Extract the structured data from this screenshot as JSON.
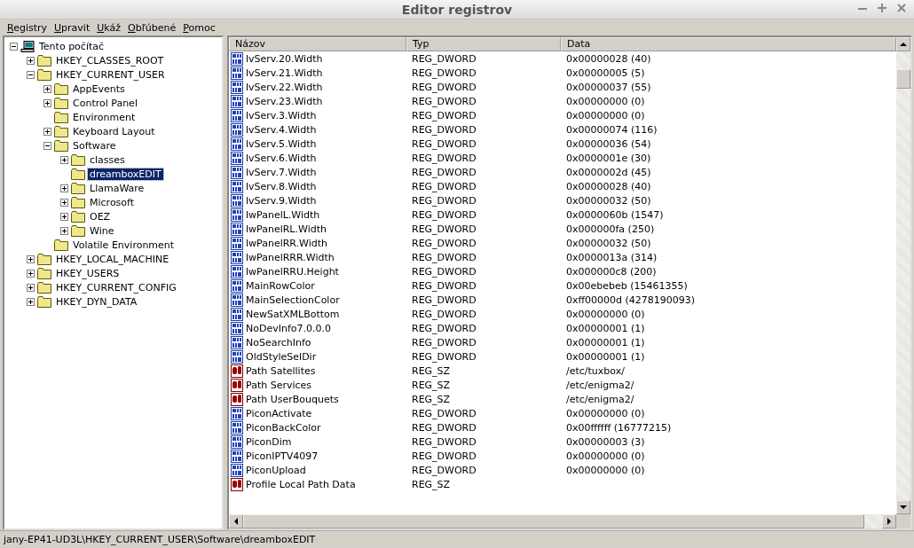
{
  "window": {
    "title": "Editor registrov"
  },
  "menu": [
    "Registry",
    "Upravit",
    "Ukáž",
    "Obľúbené",
    "Pomoc"
  ],
  "tree": [
    {
      "label": "Tento počítač",
      "kind": "computer",
      "expanded": true,
      "selected": false,
      "children": [
        {
          "label": "HKEY_CLASSES_ROOT",
          "kind": "folder",
          "expanded": false,
          "selected": false
        },
        {
          "label": "HKEY_CURRENT_USER",
          "kind": "folder",
          "expanded": true,
          "selected": false,
          "children": [
            {
              "label": "AppEvents",
              "kind": "folder",
              "expanded": false,
              "selected": false
            },
            {
              "label": "Control Panel",
              "kind": "folder",
              "expanded": false,
              "selected": false
            },
            {
              "label": "Environment",
              "kind": "folder",
              "selected": false
            },
            {
              "label": "Keyboard Layout",
              "kind": "folder",
              "expanded": false,
              "selected": false
            },
            {
              "label": "Software",
              "kind": "folder",
              "expanded": true,
              "selected": false,
              "children": [
                {
                  "label": "classes",
                  "kind": "folder",
                  "expanded": false,
                  "selected": false
                },
                {
                  "label": "dreamboxEDIT",
                  "kind": "folder",
                  "selected": true
                },
                {
                  "label": "LlamaWare",
                  "kind": "folder",
                  "expanded": false,
                  "selected": false
                },
                {
                  "label": "Microsoft",
                  "kind": "folder",
                  "expanded": false,
                  "selected": false
                },
                {
                  "label": "OEZ",
                  "kind": "folder",
                  "expanded": false,
                  "selected": false
                },
                {
                  "label": "Wine",
                  "kind": "folder",
                  "expanded": false,
                  "selected": false
                }
              ]
            },
            {
              "label": "Volatile Environment",
              "kind": "folder",
              "selected": false
            }
          ]
        },
        {
          "label": "HKEY_LOCAL_MACHINE",
          "kind": "folder",
          "expanded": false,
          "selected": false
        },
        {
          "label": "HKEY_USERS",
          "kind": "folder",
          "expanded": false,
          "selected": false
        },
        {
          "label": "HKEY_CURRENT_CONFIG",
          "kind": "folder",
          "expanded": false,
          "selected": false
        },
        {
          "label": "HKEY_DYN_DATA",
          "kind": "folder",
          "expanded": false,
          "selected": false
        }
      ]
    }
  ],
  "table": {
    "columns": [
      "Názov",
      "Typ",
      "Data"
    ],
    "rows": [
      {
        "kind": "dword",
        "name": "lvServ.20.Width",
        "type": "REG_DWORD",
        "data": "0x00000028 (40)"
      },
      {
        "kind": "dword",
        "name": "lvServ.21.Width",
        "type": "REG_DWORD",
        "data": "0x00000005 (5)"
      },
      {
        "kind": "dword",
        "name": "lvServ.22.Width",
        "type": "REG_DWORD",
        "data": "0x00000037 (55)"
      },
      {
        "kind": "dword",
        "name": "lvServ.23.Width",
        "type": "REG_DWORD",
        "data": "0x00000000 (0)"
      },
      {
        "kind": "dword",
        "name": "lvServ.3.Width",
        "type": "REG_DWORD",
        "data": "0x00000000 (0)"
      },
      {
        "kind": "dword",
        "name": "lvServ.4.Width",
        "type": "REG_DWORD",
        "data": "0x00000074 (116)"
      },
      {
        "kind": "dword",
        "name": "lvServ.5.Width",
        "type": "REG_DWORD",
        "data": "0x00000036 (54)"
      },
      {
        "kind": "dword",
        "name": "lvServ.6.Width",
        "type": "REG_DWORD",
        "data": "0x0000001e (30)"
      },
      {
        "kind": "dword",
        "name": "lvServ.7.Width",
        "type": "REG_DWORD",
        "data": "0x0000002d (45)"
      },
      {
        "kind": "dword",
        "name": "lvServ.8.Width",
        "type": "REG_DWORD",
        "data": "0x00000028 (40)"
      },
      {
        "kind": "dword",
        "name": "lvServ.9.Width",
        "type": "REG_DWORD",
        "data": "0x00000032 (50)"
      },
      {
        "kind": "dword",
        "name": "lwPanelL.Width",
        "type": "REG_DWORD",
        "data": "0x0000060b (1547)"
      },
      {
        "kind": "dword",
        "name": "lwPanelRL.Width",
        "type": "REG_DWORD",
        "data": "0x000000fa (250)"
      },
      {
        "kind": "dword",
        "name": "lwPanelRR.Width",
        "type": "REG_DWORD",
        "data": "0x00000032 (50)"
      },
      {
        "kind": "dword",
        "name": "lwPanelRRR.Width",
        "type": "REG_DWORD",
        "data": "0x0000013a (314)"
      },
      {
        "kind": "dword",
        "name": "lwPanelRRU.Height",
        "type": "REG_DWORD",
        "data": "0x000000c8 (200)"
      },
      {
        "kind": "dword",
        "name": "MainRowColor",
        "type": "REG_DWORD",
        "data": "0x00ebebeb (15461355)"
      },
      {
        "kind": "dword",
        "name": "MainSelectionColor",
        "type": "REG_DWORD",
        "data": "0xff00000d (4278190093)"
      },
      {
        "kind": "dword",
        "name": "NewSatXMLBottom",
        "type": "REG_DWORD",
        "data": "0x00000000 (0)"
      },
      {
        "kind": "dword",
        "name": "NoDevInfo7.0.0.0",
        "type": "REG_DWORD",
        "data": "0x00000001 (1)"
      },
      {
        "kind": "dword",
        "name": "NoSearchInfo",
        "type": "REG_DWORD",
        "data": "0x00000001 (1)"
      },
      {
        "kind": "dword",
        "name": "OldStyleSelDir",
        "type": "REG_DWORD",
        "data": "0x00000001 (1)"
      },
      {
        "kind": "sz",
        "name": "Path Satellites",
        "type": "REG_SZ",
        "data": "/etc/tuxbox/"
      },
      {
        "kind": "sz",
        "name": "Path Services",
        "type": "REG_SZ",
        "data": "/etc/enigma2/"
      },
      {
        "kind": "sz",
        "name": "Path UserBouquets",
        "type": "REG_SZ",
        "data": "/etc/enigma2/"
      },
      {
        "kind": "dword",
        "name": "PiconActivate",
        "type": "REG_DWORD",
        "data": "0x00000000 (0)"
      },
      {
        "kind": "dword",
        "name": "PiconBackColor",
        "type": "REG_DWORD",
        "data": "0x00ffffff (16777215)"
      },
      {
        "kind": "dword",
        "name": "PiconDim",
        "type": "REG_DWORD",
        "data": "0x00000003 (3)"
      },
      {
        "kind": "dword",
        "name": "PiconIPTV4097",
        "type": "REG_DWORD",
        "data": "0x00000000 (0)"
      },
      {
        "kind": "dword",
        "name": "PiconUpload",
        "type": "REG_DWORD",
        "data": "0x00000000 (0)"
      },
      {
        "kind": "sz",
        "name": "Profile Local Path Data",
        "type": "REG_SZ"
      }
    ]
  },
  "status_bar": "jany-EP41-UD3L\\HKEY_CURRENT_USER\\Software\\dreamboxEDIT"
}
